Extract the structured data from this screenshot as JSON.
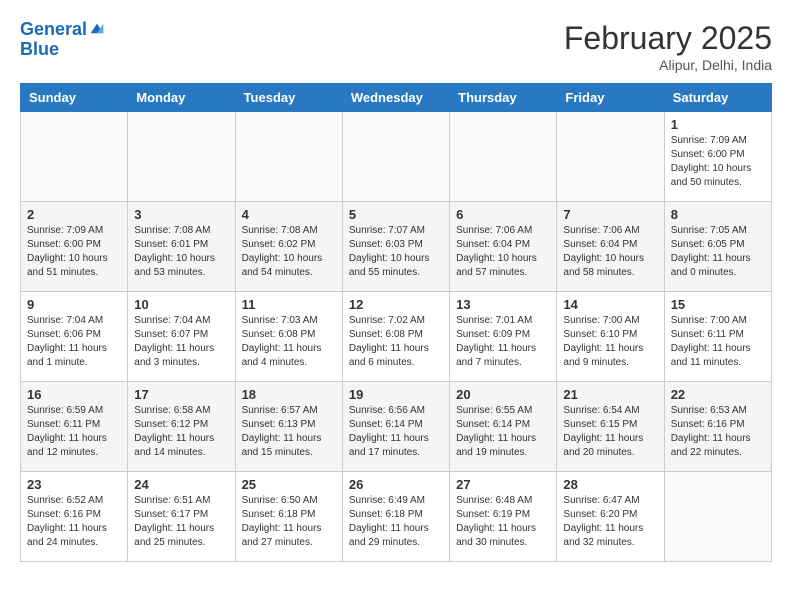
{
  "header": {
    "logo_line1": "General",
    "logo_line2": "Blue",
    "month_title": "February 2025",
    "location": "Alipur, Delhi, India"
  },
  "weekdays": [
    "Sunday",
    "Monday",
    "Tuesday",
    "Wednesday",
    "Thursday",
    "Friday",
    "Saturday"
  ],
  "weeks": [
    [
      {
        "day": "",
        "info": ""
      },
      {
        "day": "",
        "info": ""
      },
      {
        "day": "",
        "info": ""
      },
      {
        "day": "",
        "info": ""
      },
      {
        "day": "",
        "info": ""
      },
      {
        "day": "",
        "info": ""
      },
      {
        "day": "1",
        "info": "Sunrise: 7:09 AM\nSunset: 6:00 PM\nDaylight: 10 hours\nand 50 minutes."
      }
    ],
    [
      {
        "day": "2",
        "info": "Sunrise: 7:09 AM\nSunset: 6:00 PM\nDaylight: 10 hours\nand 51 minutes."
      },
      {
        "day": "3",
        "info": "Sunrise: 7:08 AM\nSunset: 6:01 PM\nDaylight: 10 hours\nand 53 minutes."
      },
      {
        "day": "4",
        "info": "Sunrise: 7:08 AM\nSunset: 6:02 PM\nDaylight: 10 hours\nand 54 minutes."
      },
      {
        "day": "5",
        "info": "Sunrise: 7:07 AM\nSunset: 6:03 PM\nDaylight: 10 hours\nand 55 minutes."
      },
      {
        "day": "6",
        "info": "Sunrise: 7:06 AM\nSunset: 6:04 PM\nDaylight: 10 hours\nand 57 minutes."
      },
      {
        "day": "7",
        "info": "Sunrise: 7:06 AM\nSunset: 6:04 PM\nDaylight: 10 hours\nand 58 minutes."
      },
      {
        "day": "8",
        "info": "Sunrise: 7:05 AM\nSunset: 6:05 PM\nDaylight: 11 hours\nand 0 minutes."
      }
    ],
    [
      {
        "day": "9",
        "info": "Sunrise: 7:04 AM\nSunset: 6:06 PM\nDaylight: 11 hours\nand 1 minute."
      },
      {
        "day": "10",
        "info": "Sunrise: 7:04 AM\nSunset: 6:07 PM\nDaylight: 11 hours\nand 3 minutes."
      },
      {
        "day": "11",
        "info": "Sunrise: 7:03 AM\nSunset: 6:08 PM\nDaylight: 11 hours\nand 4 minutes."
      },
      {
        "day": "12",
        "info": "Sunrise: 7:02 AM\nSunset: 6:08 PM\nDaylight: 11 hours\nand 6 minutes."
      },
      {
        "day": "13",
        "info": "Sunrise: 7:01 AM\nSunset: 6:09 PM\nDaylight: 11 hours\nand 7 minutes."
      },
      {
        "day": "14",
        "info": "Sunrise: 7:00 AM\nSunset: 6:10 PM\nDaylight: 11 hours\nand 9 minutes."
      },
      {
        "day": "15",
        "info": "Sunrise: 7:00 AM\nSunset: 6:11 PM\nDaylight: 11 hours\nand 11 minutes."
      }
    ],
    [
      {
        "day": "16",
        "info": "Sunrise: 6:59 AM\nSunset: 6:11 PM\nDaylight: 11 hours\nand 12 minutes."
      },
      {
        "day": "17",
        "info": "Sunrise: 6:58 AM\nSunset: 6:12 PM\nDaylight: 11 hours\nand 14 minutes."
      },
      {
        "day": "18",
        "info": "Sunrise: 6:57 AM\nSunset: 6:13 PM\nDaylight: 11 hours\nand 15 minutes."
      },
      {
        "day": "19",
        "info": "Sunrise: 6:56 AM\nSunset: 6:14 PM\nDaylight: 11 hours\nand 17 minutes."
      },
      {
        "day": "20",
        "info": "Sunrise: 6:55 AM\nSunset: 6:14 PM\nDaylight: 11 hours\nand 19 minutes."
      },
      {
        "day": "21",
        "info": "Sunrise: 6:54 AM\nSunset: 6:15 PM\nDaylight: 11 hours\nand 20 minutes."
      },
      {
        "day": "22",
        "info": "Sunrise: 6:53 AM\nSunset: 6:16 PM\nDaylight: 11 hours\nand 22 minutes."
      }
    ],
    [
      {
        "day": "23",
        "info": "Sunrise: 6:52 AM\nSunset: 6:16 PM\nDaylight: 11 hours\nand 24 minutes."
      },
      {
        "day": "24",
        "info": "Sunrise: 6:51 AM\nSunset: 6:17 PM\nDaylight: 11 hours\nand 25 minutes."
      },
      {
        "day": "25",
        "info": "Sunrise: 6:50 AM\nSunset: 6:18 PM\nDaylight: 11 hours\nand 27 minutes."
      },
      {
        "day": "26",
        "info": "Sunrise: 6:49 AM\nSunset: 6:18 PM\nDaylight: 11 hours\nand 29 minutes."
      },
      {
        "day": "27",
        "info": "Sunrise: 6:48 AM\nSunset: 6:19 PM\nDaylight: 11 hours\nand 30 minutes."
      },
      {
        "day": "28",
        "info": "Sunrise: 6:47 AM\nSunset: 6:20 PM\nDaylight: 11 hours\nand 32 minutes."
      },
      {
        "day": "",
        "info": ""
      }
    ]
  ]
}
